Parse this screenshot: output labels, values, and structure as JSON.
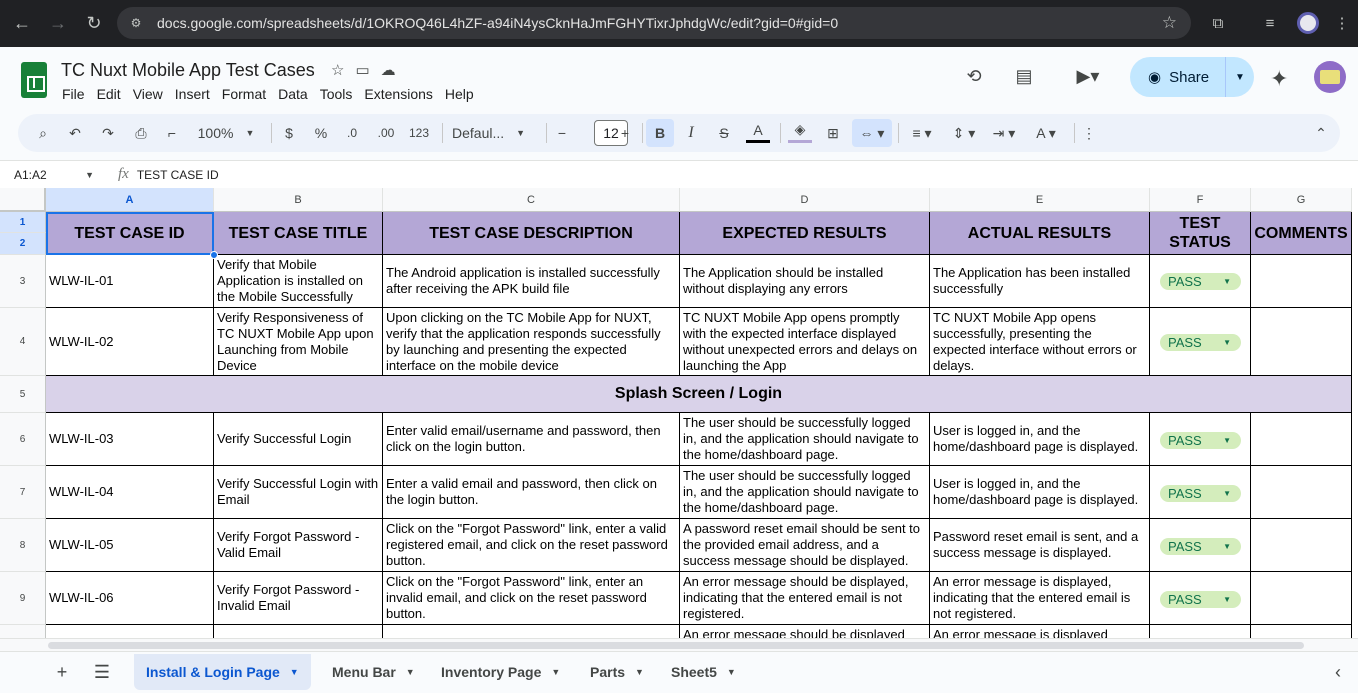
{
  "browser": {
    "url": "docs.google.com/spreadsheets/d/1OKROQ46L4hZF-a94iN4ysCknHaJmFGHYTixrJphdgWc/edit?gid=0#gid=0"
  },
  "doc": {
    "title": "TC Nuxt Mobile App Test Cases",
    "menus": [
      "File",
      "Edit",
      "View",
      "Insert",
      "Format",
      "Data",
      "Tools",
      "Extensions",
      "Help"
    ],
    "share_label": "Share"
  },
  "toolbar": {
    "zoom": "100%",
    "currency": "$",
    "percent": "%",
    "dec_decrease": ".0",
    "dec_increase": ".00",
    "number_format": "123",
    "font": "Defaul...",
    "font_size": "12",
    "bold": "B",
    "italic": "I",
    "strike": "S",
    "text_color": "A"
  },
  "formula": {
    "name_box": "A1:A2",
    "fx": "fx",
    "content": "TEST CASE ID"
  },
  "columns": [
    "A",
    "B",
    "C",
    "D",
    "E",
    "F",
    "G"
  ],
  "rows": [
    "1",
    "2",
    "3",
    "4",
    "5",
    "6",
    "7",
    "8",
    "9"
  ],
  "headers": {
    "id": "TEST CASE ID",
    "title": "TEST CASE TITLE",
    "description": "TEST CASE DESCRIPTION",
    "expected": "EXPECTED RESULTS",
    "actual": "ACTUAL RESULTS",
    "status": "TEST STATUS",
    "comments": "COMMENTS"
  },
  "section_title": "Splash Screen / Login",
  "test_cases": [
    {
      "id": "WLW-IL-01",
      "title": "Verify that Mobile Application is installed on the Mobile Successfully",
      "description": "The Android application is installed successfully after receiving the APK build file",
      "expected": "The Application should be installed without displaying any errors",
      "actual": "The Application has been installed successfully",
      "status": "PASS"
    },
    {
      "id": "WLW-IL-02",
      "title": "Verify Responsiveness of TC NUXT Mobile App upon Launching from Mobile Device",
      "description": "Upon clicking on the TC Mobile App for NUXT, verify that the application responds successfully by launching and presenting the expected interface on the mobile device",
      "expected": "TC NUXT Mobile App opens promptly with the expected interface displayed without unexpected errors and delays on launching the App",
      "actual": "TC NUXT Mobile App opens successfully, presenting the expected interface without errors or delays.",
      "status": "PASS"
    },
    {
      "id": "WLW-IL-03",
      "title": "Verify Successful Login",
      "description": "Enter valid email/username and password, then click on the login button.",
      "expected": "The user should be successfully logged in, and the application should navigate to the home/dashboard page.",
      "actual": "User is logged in, and the home/dashboard page is displayed.",
      "status": "PASS"
    },
    {
      "id": "WLW-IL-04",
      "title": "Verify Successful Login with Email",
      "description": "Enter a valid email and password, then click on the login button.",
      "expected": "The user should be successfully logged in, and the application should navigate to the home/dashboard page.",
      "actual": "User is logged in, and the home/dashboard page is displayed.",
      "status": "PASS"
    },
    {
      "id": "WLW-IL-05",
      "title": "Verify Forgot Password - Valid Email",
      "description": "Click on the \"Forgot Password\" link, enter a valid registered email, and click on the reset password button.",
      "expected": "A password reset email should be sent to the provided email address, and a success message should be displayed.",
      "actual": "Password reset email is sent, and a success message is displayed.",
      "status": "PASS"
    },
    {
      "id": "WLW-IL-06",
      "title": "Verify Forgot Password - Invalid Email",
      "description": "Click on the \"Forgot Password\" link, enter an invalid email, and click on the reset password button.",
      "expected": "An error message should be displayed, indicating that the entered email is not registered.",
      "actual": "An error message is displayed, indicating that the entered email is not registered.",
      "status": "PASS"
    }
  ],
  "partial_row": {
    "expected": "An error message should be displayed",
    "actual": "An error message is displayed"
  },
  "sheet_tabs": [
    "Install & Login Page",
    "Menu Bar",
    "Inventory Page",
    "Parts",
    "Sheet5"
  ],
  "colors": {
    "header_fill": "#b4a7d6",
    "section_fill": "#d9d2e9",
    "pass_chip": "#d4edbc",
    "accent": "#1a73e8"
  }
}
